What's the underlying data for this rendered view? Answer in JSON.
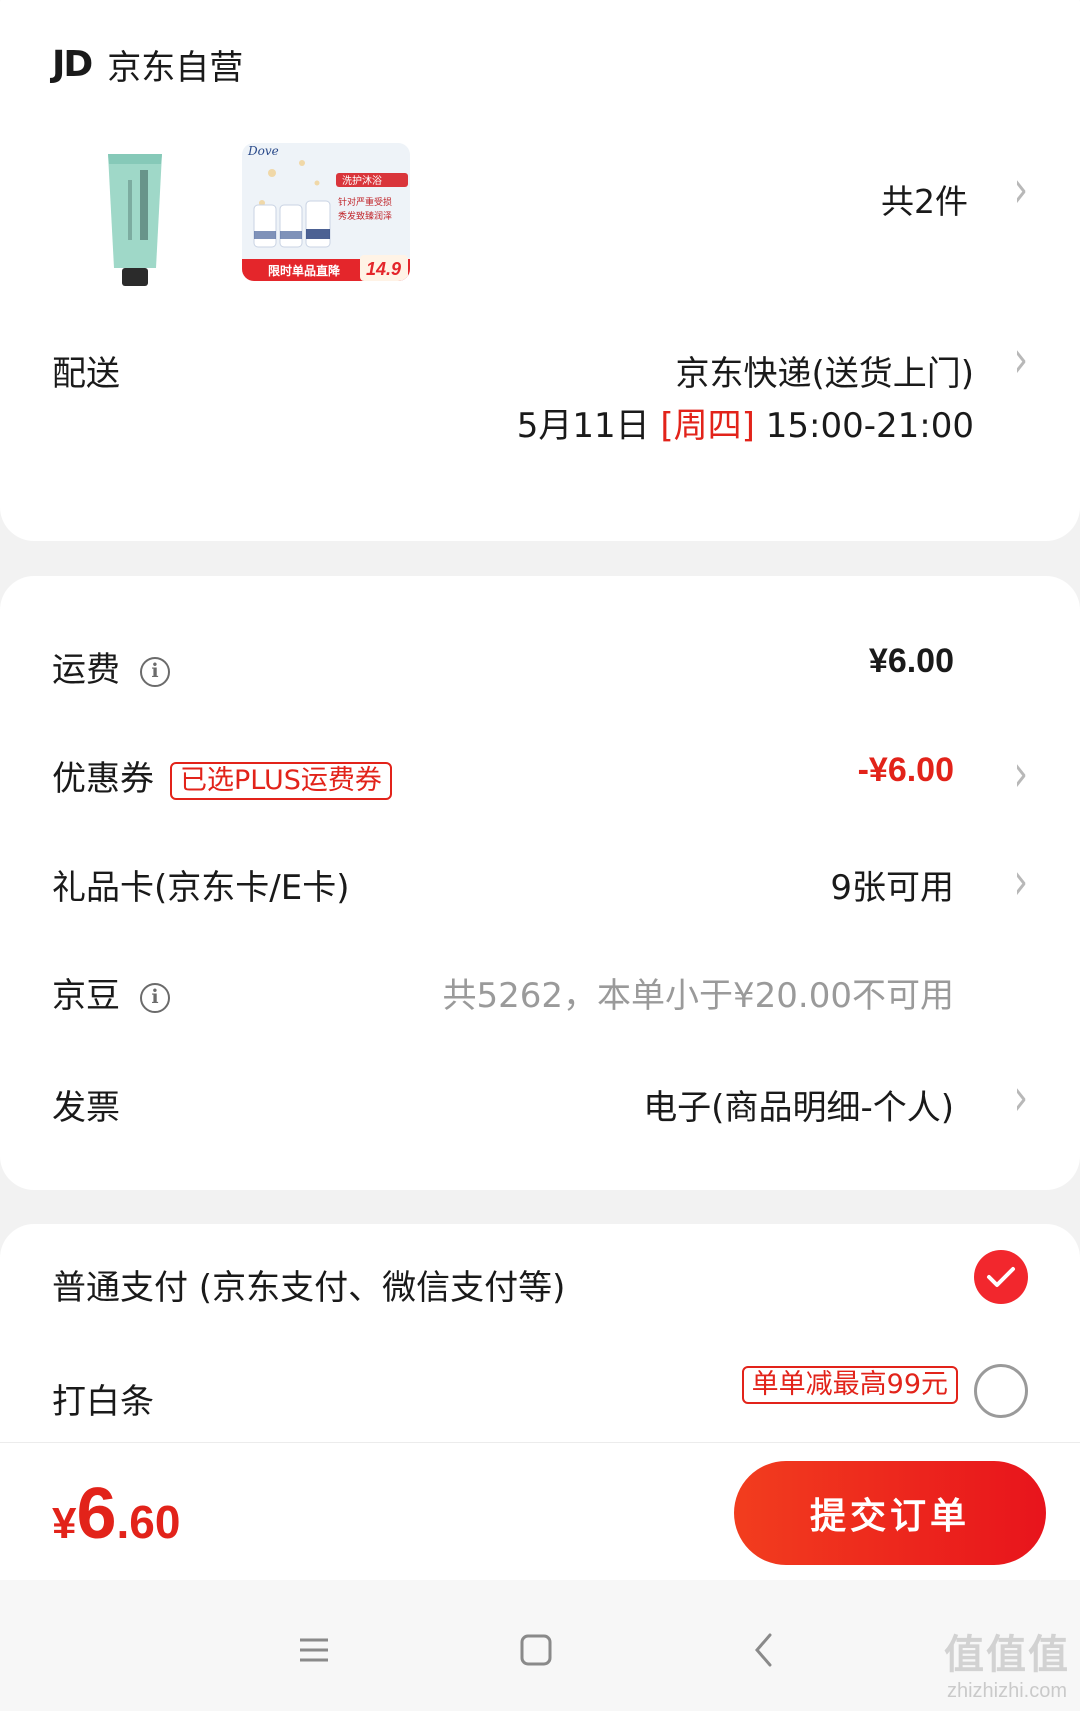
{
  "store": {
    "logo": "JD",
    "name": "京东自营",
    "item_count": "共2件",
    "product_2_tags": {
      "brand": "Dove",
      "headline": "洗护沐浴",
      "line1": "针对严重受损",
      "line2": "秀发致臻润泽",
      "ribbon": "限时单品直降",
      "price": "14.9"
    }
  },
  "delivery": {
    "label": "配送",
    "method": "京东快递(送货上门)",
    "date": "5月11日",
    "weekday": "[周四]",
    "time": "15:00-21:00"
  },
  "fees": {
    "shipping": {
      "label": "运费",
      "value": "¥6.00"
    },
    "coupon": {
      "label": "优惠券",
      "badge": "已选PLUS运费券",
      "value": "-¥6.00"
    },
    "gift_card": {
      "label": "礼品卡(京东卡/E卡)",
      "value": "9张可用"
    },
    "jingdou": {
      "label": "京豆",
      "value": "共5262，本单小于¥20.00不可用"
    },
    "invoice": {
      "label": "发票",
      "value": "电子(商品明细-个人)"
    }
  },
  "payment": {
    "normal": {
      "label": "普通支付 (京东支付、微信支付等)",
      "selected": true
    },
    "baitiao": {
      "label": "打白条",
      "promo": "单单减最高99元",
      "selected": false
    }
  },
  "footer": {
    "currency": "¥",
    "total_int": "6",
    "total_dec": ".60",
    "submit_label": "提交订单"
  },
  "watermark": {
    "logo": "值值值",
    "site": "zhizhizhi.com"
  },
  "colors": {
    "accent": "#e2231a",
    "button_gradient_start": "#f23d1e",
    "button_gradient_end": "#e8141c",
    "page_bg": "#f2f2f2"
  }
}
